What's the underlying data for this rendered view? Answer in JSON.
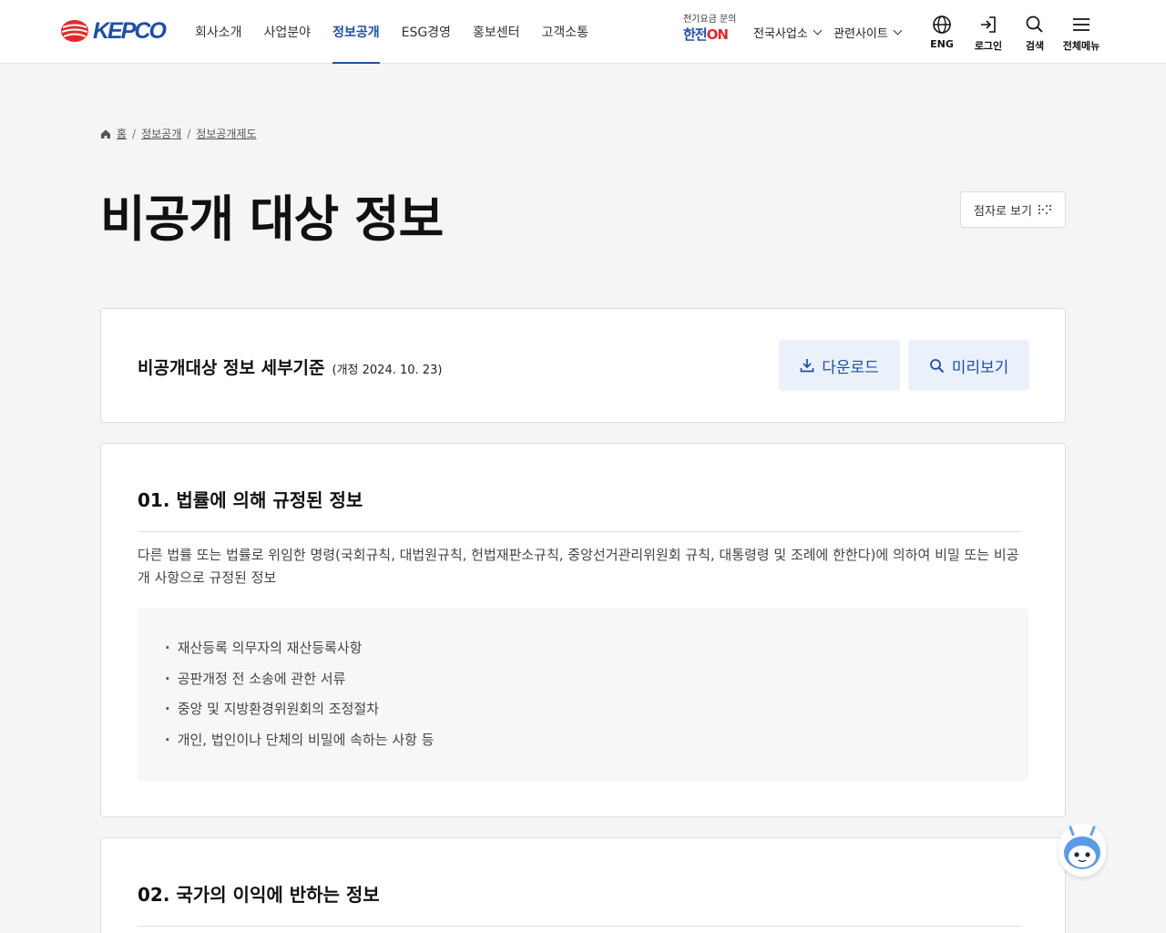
{
  "header": {
    "logo_text": "KEPCO",
    "nav": [
      "회사소개",
      "사업분야",
      "정보공개",
      "ESG경영",
      "홍보센터",
      "고객소통"
    ],
    "active_nav": 2,
    "kepco_on": {
      "small": "전기요금 문의",
      "big_main": "한전",
      "big_accent": "ON"
    },
    "dropdowns": [
      "전국사업소",
      "관련사이트"
    ],
    "utils": [
      {
        "icon": "globe-icon",
        "label": "ENG"
      },
      {
        "icon": "login-icon",
        "label": "로그인"
      },
      {
        "icon": "search-icon",
        "label": "검색"
      },
      {
        "icon": "menu-icon",
        "label": "전체메뉴"
      }
    ]
  },
  "breadcrumb": [
    "홈",
    "정보공개",
    "정보공개제도"
  ],
  "page_title": "비공개 대상 정보",
  "braille_label": "점자로 보기",
  "criteria": {
    "title": "비공개대상 정보 세부기준",
    "revision": "(개정 2024. 10. 23)",
    "download_label": "다운로드",
    "preview_label": "미리보기"
  },
  "sections": [
    {
      "title": "01. 법률에 의해 규정된 정보",
      "desc": "다른 법률 또는 법률로 위임한 명령(국회규칙, 대법원규칙, 헌법재판소규칙, 중앙선거관리위원회 규칙, 대통령령 및 조례에 한한다)에 의하여 비밀 또는 비공개 사항으로 규정된 정보",
      "items": [
        "재산등록 의무자의 재산등록사항",
        "공판개정 전 소송에 관한 서류",
        "중앙 및 지방환경위원회의 조정절차",
        "개인, 법인이나 단체의 비밀에 속하는 사항 등"
      ]
    },
    {
      "title": "02. 국가의 이익에 반하는 정보"
    }
  ],
  "colors": {
    "primary": "#1e4fa3",
    "accent_red": "#e02b2b",
    "button_bg": "#eaf1fa"
  }
}
